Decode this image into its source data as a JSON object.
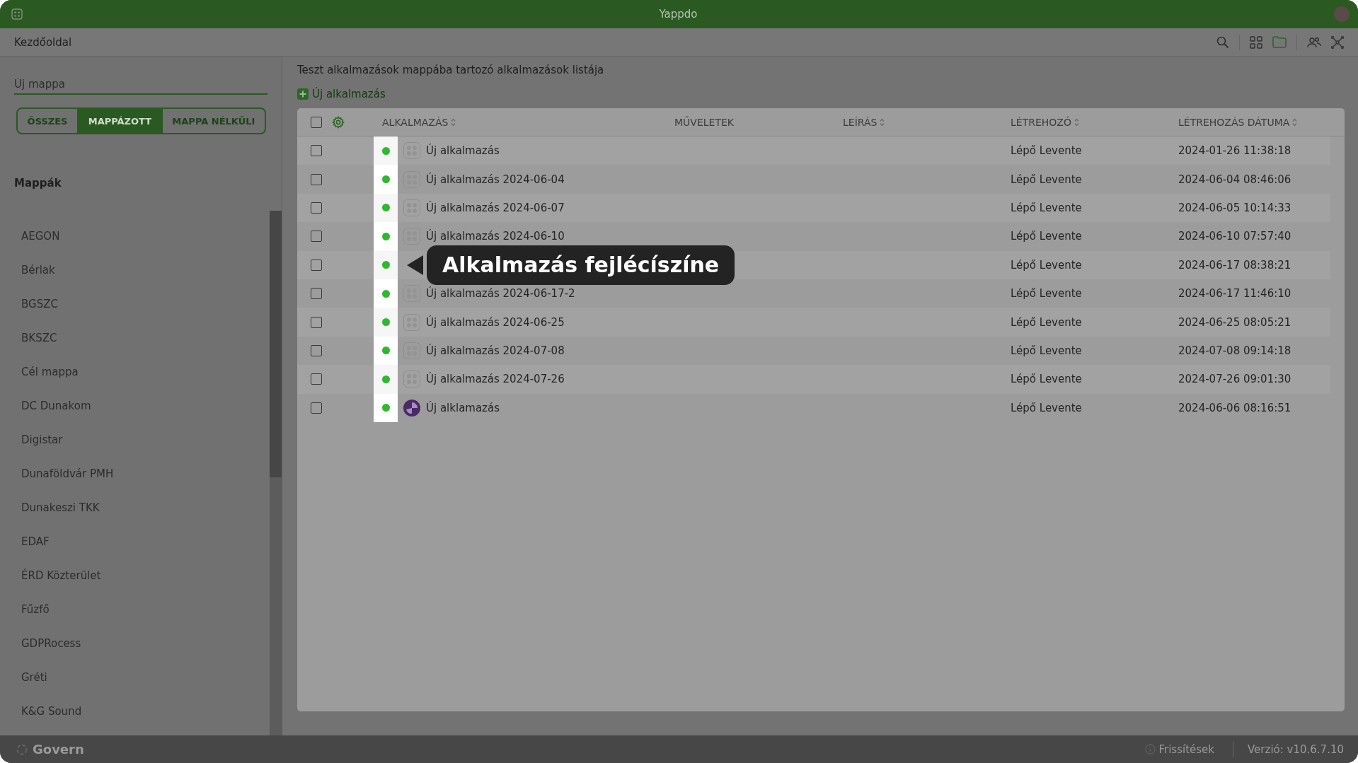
{
  "window": {
    "title": "Yappdo"
  },
  "breadcrumb": "Kezdőoldal",
  "sidebar": {
    "new_folder": {
      "placeholder": "Új mappa"
    },
    "filters": [
      {
        "label": "ÖSSZES",
        "selected": false
      },
      {
        "label": "MAPPÁZOTT",
        "selected": true
      },
      {
        "label": "MAPPA NÉLKÜLI",
        "selected": false
      }
    ],
    "folders_title": "Mappák",
    "folders": [
      "AEGON",
      "Bérlak",
      "BGSZC",
      "BKSZC",
      "Cél mappa",
      "DC Dunakom",
      "Digistar",
      "Dunaföldvár PMH",
      "Dunakeszi TKK",
      "EDAF",
      "ÉRD Közterület",
      "Fűzfő",
      "GDPRocess",
      "Gréti",
      "K&G Sound"
    ]
  },
  "main": {
    "title": "Teszt alkalmazások mappába tartozó alkalmazások listája",
    "new_button": "Új alkalmazás",
    "table": {
      "all_checked": false,
      "columns": [
        {
          "label": "ALKALMAZÁS",
          "sortable": true
        },
        {
          "label": "MŰVELETEK",
          "sortable": false
        },
        {
          "label": "LEÍRÁS",
          "sortable": true
        },
        {
          "label": "LÉTREHOZÓ",
          "sortable": true
        },
        {
          "label": "LÉTREHOZÁS DÁTUMA",
          "sortable": true
        }
      ],
      "rows": [
        {
          "checked": false,
          "color": "#2eb82e",
          "kind": "placeholder",
          "name": "Új alkalmazás",
          "creator": "Lépő Levente",
          "created": "2024-01-26 11:38:18"
        },
        {
          "checked": false,
          "color": "#2eb82e",
          "kind": "placeholder",
          "name": "Új alkalmazás 2024-06-04",
          "creator": "Lépő Levente",
          "created": "2024-06-04 08:46:06"
        },
        {
          "checked": false,
          "color": "#2eb82e",
          "kind": "placeholder",
          "name": "Új alkalmazás 2024-06-07",
          "creator": "Lépő Levente",
          "created": "2024-06-05 10:14:33"
        },
        {
          "checked": false,
          "color": "#2eb82e",
          "kind": "placeholder",
          "name": "Új alkalmazás 2024-06-10",
          "creator": "Lépő Levente",
          "created": "2024-06-10 07:57:40"
        },
        {
          "checked": false,
          "color": "#2eb82e",
          "creator": "Lépő Levente",
          "created": "2024-06-17 08:38:21"
        },
        {
          "checked": false,
          "color": "#2eb82e",
          "kind": "placeholder",
          "name": "Új alkalmazás 2024-06-17-2",
          "creator": "Lépő Levente",
          "created": "2024-06-17 11:46:10"
        },
        {
          "checked": false,
          "color": "#2eb82e",
          "kind": "placeholder",
          "name": "Új alkalmazás 2024-06-25",
          "creator": "Lépő Levente",
          "created": "2024-06-25 08:05:21"
        },
        {
          "checked": false,
          "color": "#2eb82e",
          "kind": "placeholder",
          "name": "Új alkalmazás 2024-07-08",
          "creator": "Lépő Levente",
          "created": "2024-07-08 09:14:18"
        },
        {
          "checked": false,
          "color": "#2eb82e",
          "kind": "placeholder",
          "name": "Új alkalmazás 2024-07-26",
          "creator": "Lépő Levente",
          "created": "2024-07-26 09:01:30"
        },
        {
          "checked": false,
          "color": "#2eb82e",
          "kind": "logo",
          "name": "Új alklamazás",
          "creator": "Lépő Levente",
          "created": "2024-06-06 08:16:51"
        }
      ]
    },
    "tooltip": "Alkalmazás fejlécíszíne"
  },
  "footer": {
    "brand": "Govern",
    "updates": "Frissítések",
    "version": "Verzió: v10.6.7.10"
  }
}
